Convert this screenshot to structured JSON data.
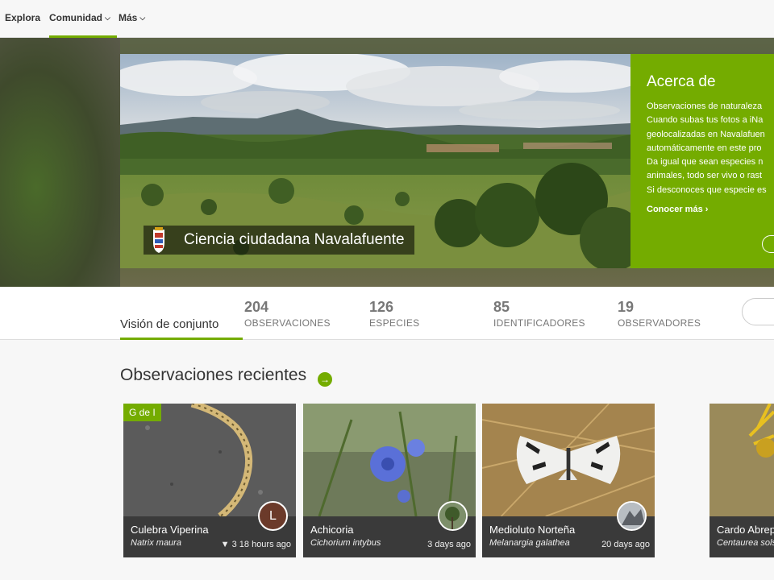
{
  "nav": {
    "items": [
      {
        "label": "Explora",
        "has_menu": false
      },
      {
        "label": "Comunidad",
        "has_menu": true,
        "active": true
      },
      {
        "label": "Más",
        "has_menu": true
      }
    ]
  },
  "project": {
    "title": "Ciencia ciudadana Navalafuente"
  },
  "about": {
    "title": "Acerca de",
    "lines": [
      "Observaciones de naturaleza",
      "Cuando subas tus fotos a iNa",
      "geolocalizadas en Navalafuen",
      "automáticamente en este pro",
      "Da igual que sean especies n",
      "animales, todo ser vivo o rast",
      "Si desconoces que especie es"
    ],
    "more_link": "Conocer más ›"
  },
  "stats": {
    "overview_tab": "Visión de conjunto",
    "items": [
      {
        "value": "204",
        "label": "OBSERVACIONES"
      },
      {
        "value": "126",
        "label": "ESPECIES"
      },
      {
        "value": "85",
        "label": "IDENTIFICADORES"
      },
      {
        "value": "19",
        "label": "OBSERVADORES"
      }
    ]
  },
  "observations": {
    "heading": "Observaciones recientes",
    "arrow_icon": "arrow-right-circle-icon",
    "cards": [
      {
        "common": "Culebra Viperina",
        "scientific": "Natrix maura",
        "ids": "3",
        "time": "18 hours ago",
        "badge": "G de I",
        "avatar_letter": "L"
      },
      {
        "common": "Achicoria",
        "scientific": "Cichorium intybus",
        "time": "3 days ago"
      },
      {
        "common": "Medioluto Norteña",
        "scientific": "Melanargia galathea",
        "time": "20 days ago"
      },
      {
        "common": "Cardo Abrep",
        "scientific": "Centaurea sols",
        "time": ""
      }
    ]
  },
  "colors": {
    "accent": "#74ac00",
    "caption_bg": "#3a3a3a",
    "avatar_bg": "#6b3a2a"
  }
}
